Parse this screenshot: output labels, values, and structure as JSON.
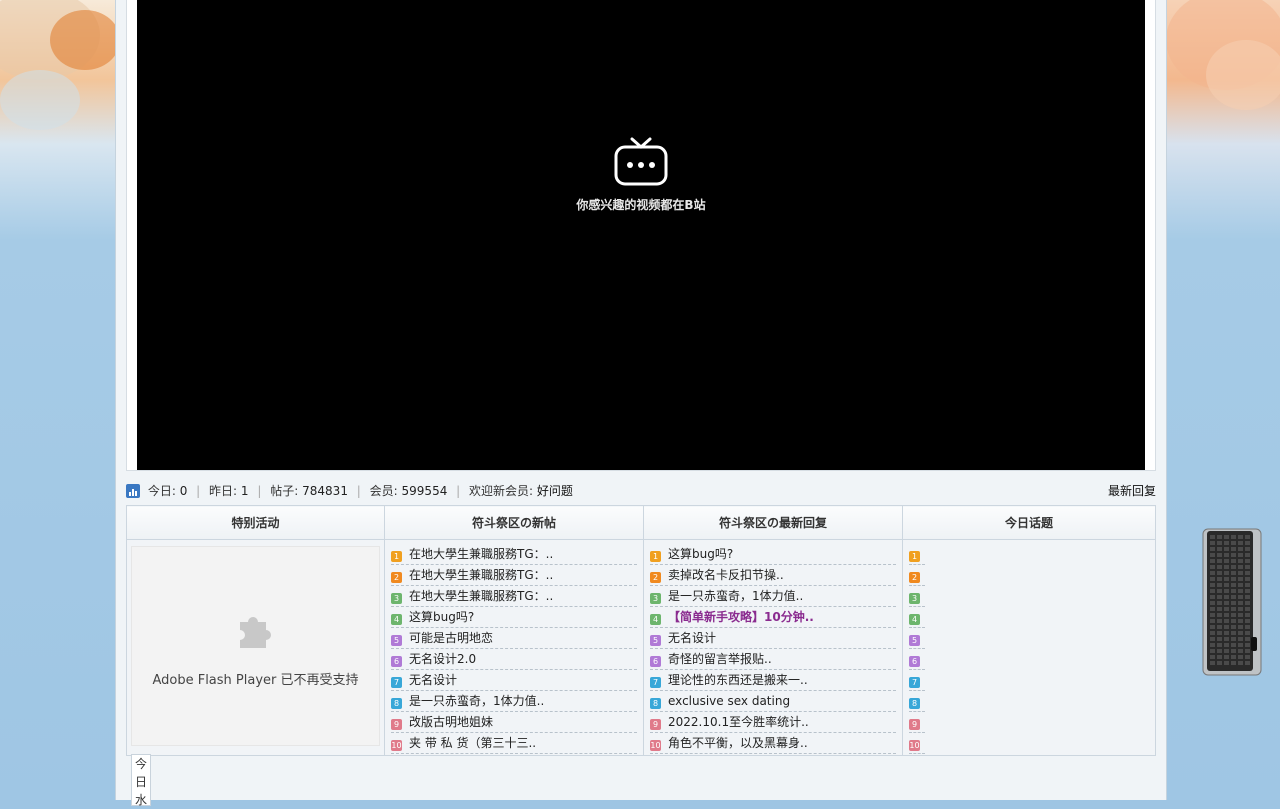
{
  "video": {
    "message": "你感兴趣的视频都在B站"
  },
  "stats": {
    "today_label": "今日:",
    "today_value": "0",
    "yesterday_label": "昨日:",
    "yesterday_value": "1",
    "posts_label": "帖子:",
    "posts_value": "784831",
    "members_label": "会员:",
    "members_value": "599554",
    "welcome_label": "欢迎新会员:",
    "welcome_value": "好问题",
    "latest_reply": "最新回复"
  },
  "table": {
    "headers": [
      "特别活动",
      "符斗祭区の新帖",
      "符斗祭区の最新回复",
      "今日话题"
    ],
    "flash_message": "Adobe Flash Player 已不再受支持",
    "num_colors": [
      "#f0a020",
      "#f08a20",
      "#6db56d",
      "#6db56d",
      "#b07ad6",
      "#b07ad6",
      "#38a7d8",
      "#38a7d8",
      "#e07a8a",
      "#e07a8a"
    ],
    "new_posts": [
      "在地大學生兼職服務TG：..",
      "在地大學生兼職服務TG：..",
      "在地大學生兼職服務TG：..",
      "这算bug吗?",
      "可能是古明地恋",
      "无名设计2.0",
      "无名设计",
      "是一只赤蛮奇，1体力值..",
      "改版古明地姐妹",
      "夹 带 私 货（第三十三.."
    ],
    "latest_replies": [
      "这算bug吗?",
      "卖掉改名卡反扣节操..",
      "是一只赤蛮奇，1体力值..",
      "【简单新手攻略】10分钟..",
      "无名设计",
      "奇怪的留言举报贴..",
      "理论性的东西还是搬来一..",
      "exclusive sex dating",
      "2022.10.1至今胜率统计..",
      "角色不平衡，以及黑幕身.."
    ],
    "highlight_reply_index": 3
  },
  "today_box": {
    "text": "今日水"
  }
}
